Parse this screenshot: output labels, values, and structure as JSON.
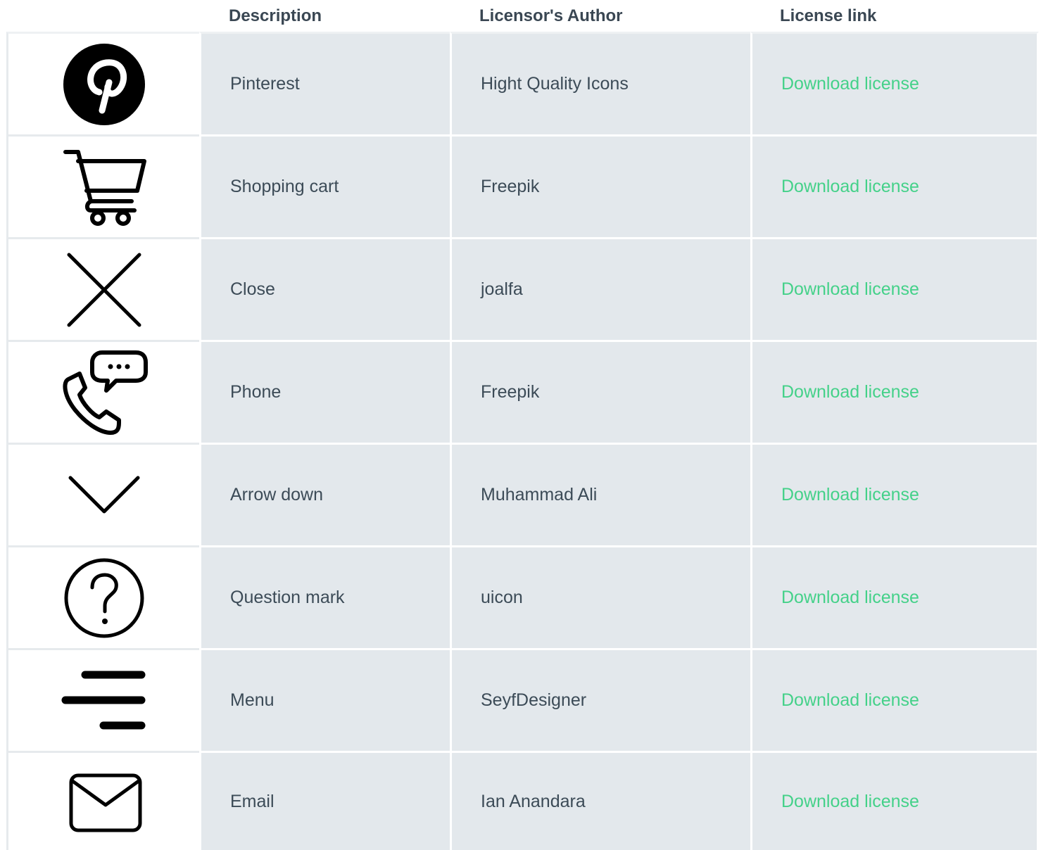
{
  "columns": {
    "icon": "",
    "description": "Description",
    "author": "Licensor's Author",
    "link": "License link"
  },
  "rows": [
    {
      "icon": "pinterest-icon",
      "description": "Pinterest",
      "author": "Hight Quality Icons",
      "link": "Download license"
    },
    {
      "icon": "shopping-cart-icon",
      "description": "Shopping cart",
      "author": "Freepik",
      "link": "Download license"
    },
    {
      "icon": "close-icon",
      "description": "Close",
      "author": "joalfa",
      "link": "Download license"
    },
    {
      "icon": "phone-chat-icon",
      "description": "Phone",
      "author": "Freepik",
      "link": "Download license"
    },
    {
      "icon": "chevron-down-icon",
      "description": "Arrow down",
      "author": "Muhammad Ali",
      "link": "Download license"
    },
    {
      "icon": "question-mark-icon",
      "description": "Question mark",
      "author": "uicon",
      "link": "Download license"
    },
    {
      "icon": "menu-icon",
      "description": "Menu",
      "author": "SeyfDesigner",
      "link": "Download license"
    },
    {
      "icon": "email-icon",
      "description": "Email",
      "author": "Ian Anandara",
      "link": "Download license"
    }
  ],
  "colors": {
    "link": "#44d189",
    "row_background": "#e3e8ec",
    "text": "#3c4b57",
    "header_text": "#3a4753"
  }
}
